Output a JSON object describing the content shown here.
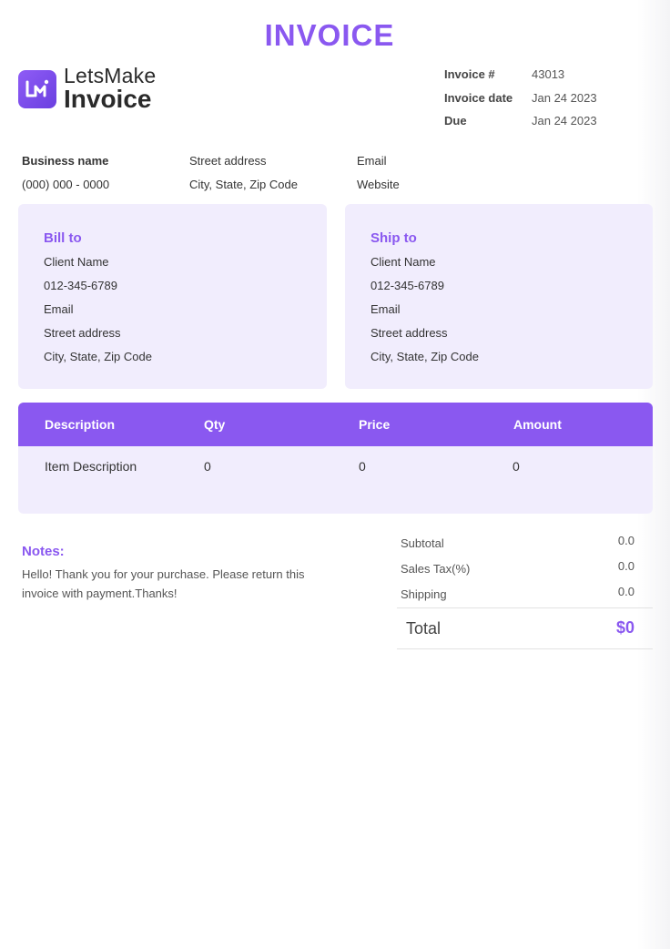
{
  "title": "INVOICE",
  "logo": {
    "top": "LetsMake",
    "bottom": "Invoice",
    "icon": "lm-logo-icon",
    "color": "#8a58f0"
  },
  "meta": {
    "number_label": "Invoice #",
    "number": "43013",
    "date_label": "Invoice date",
    "date": "Jan 24 2023",
    "due_label": "Due",
    "due": "Jan 24 2023"
  },
  "business": {
    "name": "Business name",
    "phone": "(000) 000 - 0000",
    "street": "Street address",
    "city": "City, State, Zip Code",
    "email": "Email",
    "website": "Website"
  },
  "bill_to": {
    "title": "Bill to",
    "name": "Client Name",
    "phone": "012-345-6789",
    "email": "Email",
    "street": "Street address",
    "city": "City, State, Zip Code"
  },
  "ship_to": {
    "title": "Ship to",
    "name": "Client Name",
    "phone": "012-345-6789",
    "email": "Email",
    "street": "Street address",
    "city": "City, State, Zip Code"
  },
  "items_table": {
    "headers": {
      "description": "Description",
      "qty": "Qty",
      "price": "Price",
      "amount": "Amount"
    },
    "rows": [
      {
        "description": "Item Description",
        "qty": "0",
        "price": "0",
        "amount": "0"
      }
    ]
  },
  "notes": {
    "title": "Notes:",
    "text": "Hello! Thank you for your purchase. Please return this invoice with payment.Thanks!"
  },
  "totals": {
    "subtotal_label": "Subtotal",
    "subtotal": "0.0",
    "tax_label": "Sales Tax(%)",
    "tax": "0.0",
    "shipping_label": "Shipping",
    "shipping": "0.0",
    "total_label": "Total",
    "total": "$0"
  }
}
